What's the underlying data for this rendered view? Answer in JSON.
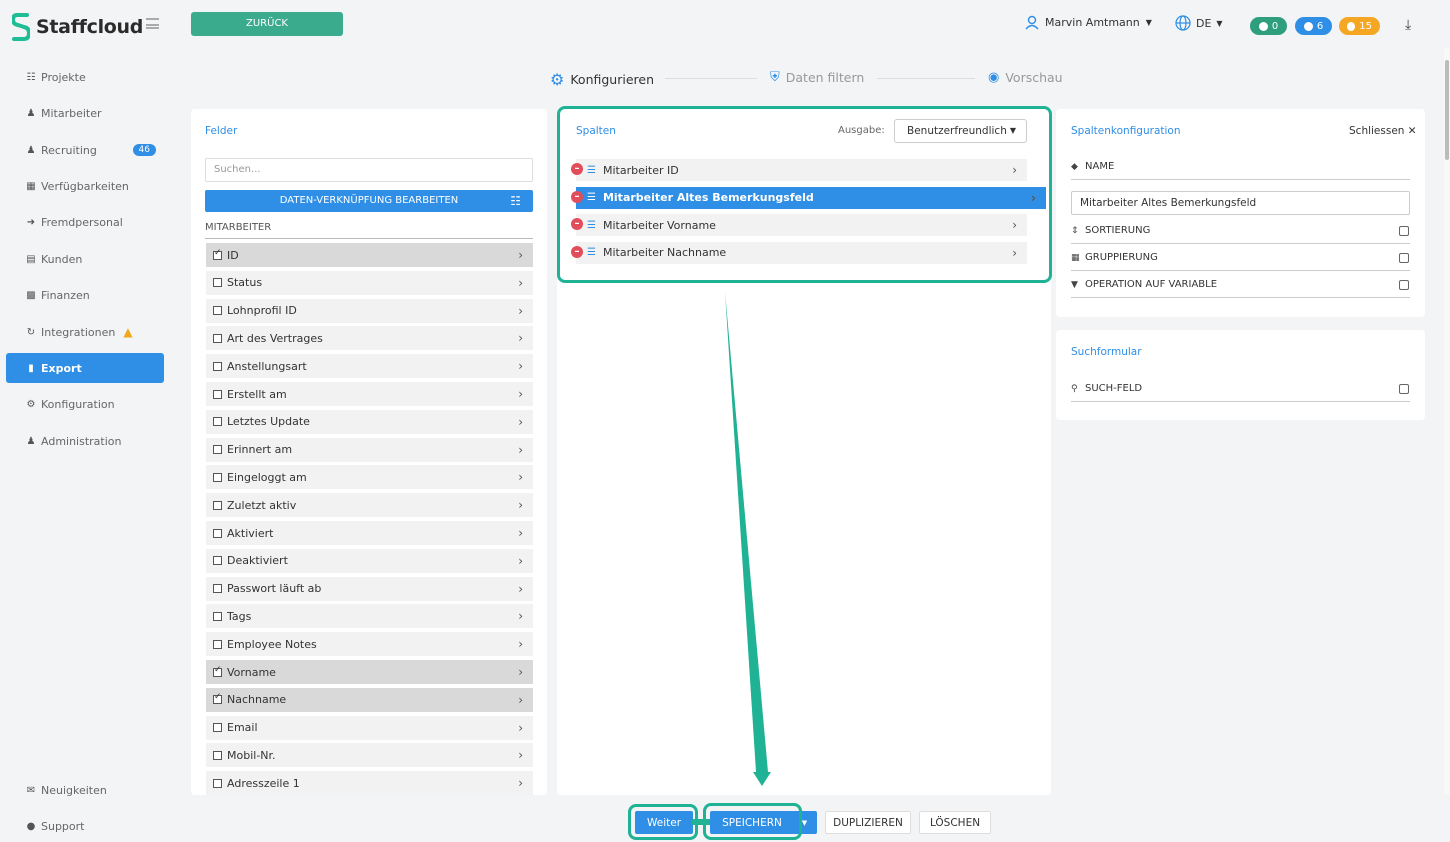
{
  "app": {
    "name": "Staffcloud",
    "back_label": "ZURÜCK"
  },
  "user": {
    "name": "Marvin Amtmann"
  },
  "language": {
    "code": "DE"
  },
  "counters": [
    {
      "value": "0",
      "color": "#2e9e7d"
    },
    {
      "value": "6",
      "color": "#2f8ee5"
    },
    {
      "value": "15",
      "color": "#f5a623"
    }
  ],
  "sidebar": {
    "items": [
      {
        "label": "Projekte",
        "icon": "sitemap-icon"
      },
      {
        "label": "Mitarbeiter",
        "icon": "users-icon"
      },
      {
        "label": "Recruiting",
        "icon": "user-plus-icon",
        "badge": "46"
      },
      {
        "label": "Verfügbarkeiten",
        "icon": "calendar-icon"
      },
      {
        "label": "Fremdpersonal",
        "icon": "sign-in-icon"
      },
      {
        "label": "Kunden",
        "icon": "building-icon"
      },
      {
        "label": "Finanzen",
        "icon": "money-icon"
      },
      {
        "label": "Integrationen",
        "icon": "sync-icon"
      },
      {
        "label": "Export",
        "icon": "file-icon"
      },
      {
        "label": "Konfiguration",
        "icon": "gear-icon"
      },
      {
        "label": "Administration",
        "icon": "user-lock-icon"
      }
    ],
    "bottom": [
      {
        "label": "Neuigkeiten",
        "icon": "megaphone-icon"
      },
      {
        "label": "Support",
        "icon": "support-icon"
      }
    ]
  },
  "steps": [
    {
      "label": "Konfigurieren",
      "active": true
    },
    {
      "label": "Daten filtern",
      "active": false
    },
    {
      "label": "Vorschau",
      "active": false
    }
  ],
  "fields": {
    "title": "Felder",
    "search_placeholder": "Suchen...",
    "link_button": "DATEN-VERKNÜPFUNG BEARBEITEN",
    "group": "MITARBEITER",
    "items": [
      {
        "label": "ID",
        "checked": true
      },
      {
        "label": "Status",
        "checked": false
      },
      {
        "label": "Lohnprofil ID",
        "checked": false
      },
      {
        "label": "Art des Vertrages",
        "checked": false
      },
      {
        "label": "Anstellungsart",
        "checked": false
      },
      {
        "label": "Erstellt am",
        "checked": false
      },
      {
        "label": "Letztes Update",
        "checked": false
      },
      {
        "label": "Erinnert am",
        "checked": false
      },
      {
        "label": "Eingeloggt am",
        "checked": false
      },
      {
        "label": "Zuletzt aktiv",
        "checked": false
      },
      {
        "label": "Aktiviert",
        "checked": false
      },
      {
        "label": "Deaktiviert",
        "checked": false
      },
      {
        "label": "Passwort läuft ab",
        "checked": false
      },
      {
        "label": "Tags",
        "checked": false
      },
      {
        "label": "Employee Notes",
        "checked": false
      },
      {
        "label": "Vorname",
        "checked": true
      },
      {
        "label": "Nachname",
        "checked": true
      },
      {
        "label": "Email",
        "checked": false
      },
      {
        "label": "Mobil-Nr.",
        "checked": false
      },
      {
        "label": "Adresszeile 1",
        "checked": false
      }
    ]
  },
  "columns": {
    "title": "Spalten",
    "output_label": "Ausgabe:",
    "output_value": "Benutzerfreundlich",
    "items": [
      {
        "label": "Mitarbeiter ID",
        "selected": false
      },
      {
        "label": "Mitarbeiter Altes Bemerkungsfeld",
        "selected": true
      },
      {
        "label": "Mitarbeiter Vorname",
        "selected": false
      },
      {
        "label": "Mitarbeiter Nachname",
        "selected": false
      }
    ]
  },
  "config": {
    "title": "Spaltenkonfiguration",
    "close_label": "Schliessen",
    "name_label": "NAME",
    "name_value": "Mitarbeiter Altes Bemerkungsfeld",
    "options": [
      {
        "label": "SORTIERUNG",
        "icon": "sort-icon",
        "checked": false
      },
      {
        "label": "GRUPPIERUNG",
        "icon": "table-icon",
        "checked": false
      },
      {
        "label": "OPERATION AUF VARIABLE",
        "icon": "filter-icon",
        "checked": false
      }
    ]
  },
  "search_form": {
    "title": "Suchformular",
    "field_label": "SUCH-FELD",
    "checked": false
  },
  "actions": {
    "next": "Weiter",
    "save": "SPEICHERN",
    "duplicate": "DUPLIZIEREN",
    "delete": "LÖSCHEN"
  },
  "colors": {
    "accent": "#2f8ee5",
    "highlight": "#20b294",
    "brand": "#3bab8e"
  }
}
